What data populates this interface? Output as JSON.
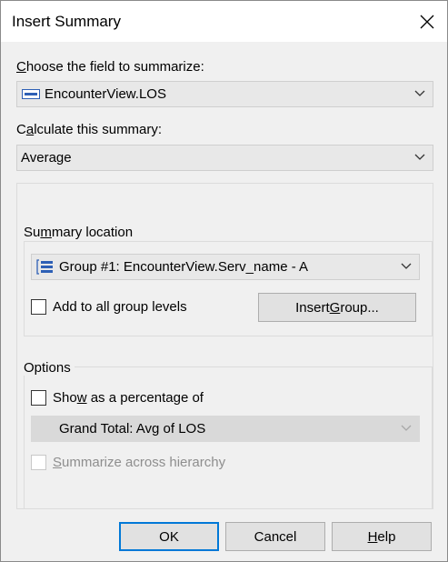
{
  "dialog": {
    "title": "Insert Summary",
    "close_icon": "close-icon"
  },
  "field": {
    "label_prefix": "",
    "label_mnemonic": "C",
    "label_rest": "hoose the field to summarize:",
    "value": "EncounterView.LOS",
    "icon": "database-field-icon"
  },
  "summary": {
    "label_prefix": "C",
    "label_mnemonic": "a",
    "label_rest": "lculate this summary:",
    "value": "Average"
  },
  "location": {
    "legend_prefix": "Su",
    "legend_mnemonic": "m",
    "legend_rest": "mary location",
    "value": "Group #1: EncounterView.Serv_name - A",
    "icon": "group-icon",
    "add_all_label": "Add to all group levels",
    "add_all_checked": false,
    "insert_group_prefix": "Insert ",
    "insert_group_mnemonic": "G",
    "insert_group_rest": "roup..."
  },
  "options": {
    "legend": "Options",
    "show_pct_prefix": "Sho",
    "show_pct_mnemonic": "w",
    "show_pct_rest": " as a percentage of",
    "show_pct_checked": false,
    "pct_value": "Grand Total: Avg of LOS",
    "summarize_mnemonic": "S",
    "summarize_rest": "ummarize across hierarchy",
    "summarize_checked": false
  },
  "buttons": {
    "ok": "OK",
    "cancel": "Cancel",
    "help_mnemonic": "H",
    "help_rest": "elp"
  },
  "colors": {
    "accent": "#0078d7"
  }
}
